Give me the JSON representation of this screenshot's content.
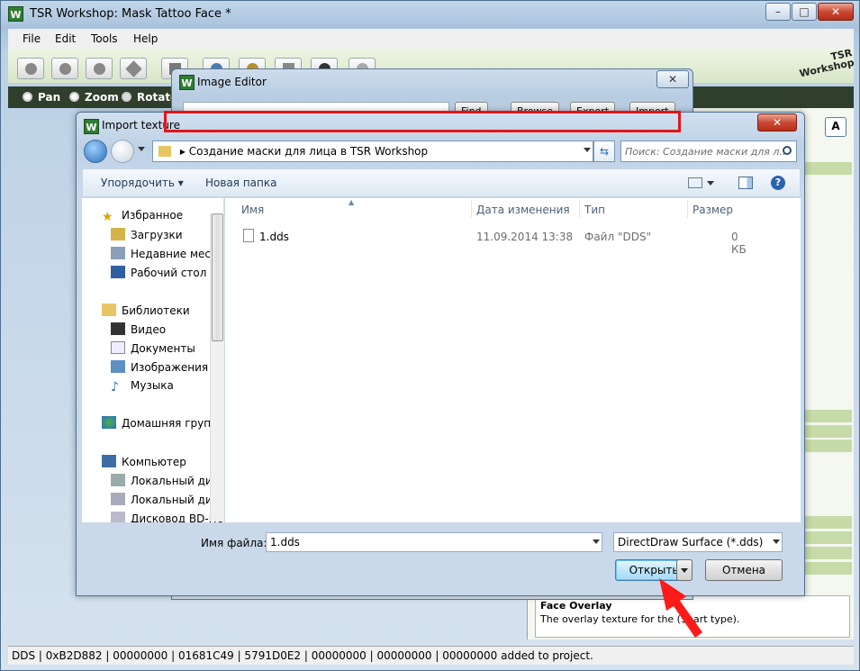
{
  "main": {
    "title": "TSR Workshop: Mask Tattoo Face *",
    "logo_text": "W",
    "window_controls": {
      "minimize": "–",
      "maximize": "□",
      "close": "✕"
    },
    "menu": [
      "File",
      "Edit",
      "Tools",
      "Help"
    ],
    "brand": "TSR Workshop",
    "nav_modes": [
      "Pan",
      "Zoom",
      "Rotate"
    ],
    "right_button": "A",
    "face_overlay": {
      "title": "Face Overlay",
      "desc": "The overlay texture for the ($part type)."
    },
    "status": "DDS | 0xB2D882 | 00000000 | 01681C49 | 5791D0E2 | 00000000 | 00000000 | 00000000 added to project."
  },
  "image_editor": {
    "title": "Image Editor",
    "buttons": [
      "Find",
      "Browse",
      "Export",
      "Import"
    ]
  },
  "dialog": {
    "title": "Import texture",
    "close": "✕",
    "path": "Создание маски для лица в TSR Workshop",
    "search_placeholder": "Поиск: Создание маски для л...",
    "toolbar": {
      "organize": "Упорядочить ▾",
      "new_folder": "Новая папка"
    },
    "nav": {
      "favorites": "Избранное",
      "downloads": "Загрузки",
      "recent": "Недавние места",
      "desktop": "Рабочий стол",
      "libraries": "Библиотеки",
      "video": "Видео",
      "documents": "Документы",
      "images": "Изображения",
      "music": "Музыка",
      "homegroup": "Домашняя группа",
      "computer": "Компьютер",
      "local_c": "Локальный диск",
      "local_d": "Локальный диск",
      "bd": "Дисковод BD-ROM"
    },
    "columns": {
      "name": "Имя",
      "date": "Дата изменения",
      "type": "Тип",
      "size": "Размер"
    },
    "files": [
      {
        "name": "1.dds",
        "date": "11.09.2014 13:38",
        "type": "Файл \"DDS\"",
        "size": "0 КБ"
      }
    ],
    "filename_label": "Имя файла:",
    "filename_value": "1.dds",
    "filter": "DirectDraw Surface (*.dds)",
    "open_button": "Открыть",
    "cancel_button": "Отмена"
  },
  "colors": {
    "highlight": "#e3151a",
    "accent_green": "#c6dba7",
    "arrow": "#ff1a1a"
  }
}
